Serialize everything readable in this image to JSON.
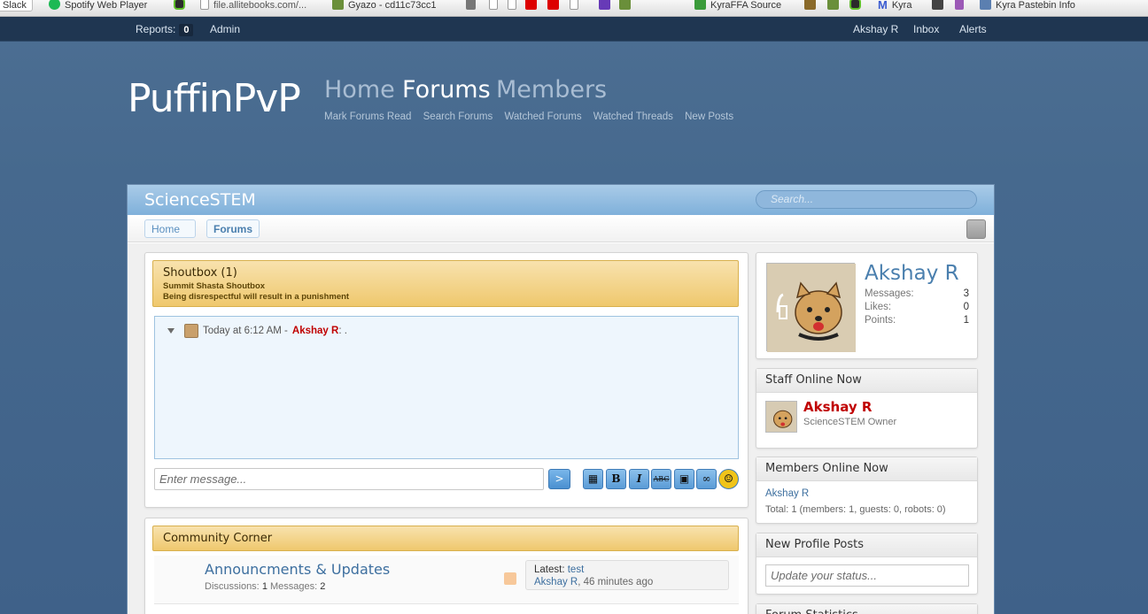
{
  "bookmarks": [
    {
      "label": "Slack"
    },
    {
      "label": "Spotify Web Player"
    },
    {
      "label": ""
    },
    {
      "label": "file.allitebooks.com/..."
    },
    {
      "label": "Gyazo - cd11c73cc1"
    },
    {
      "label": "KyraFFA Source"
    },
    {
      "label": "Kyra"
    },
    {
      "label": "Kyra Pastebin Info"
    }
  ],
  "topnav": {
    "reports_label": "Reports:",
    "reports_count": "0",
    "admin": "Admin",
    "user": "Akshay R",
    "inbox": "Inbox",
    "alerts": "Alerts"
  },
  "header": {
    "logo": "PuffinPvP",
    "tabs": [
      "Home",
      "Forums",
      "Members"
    ],
    "sublinks": [
      "Mark Forums Read",
      "Search Forums",
      "Watched Forums",
      "Watched Threads",
      "New Posts"
    ]
  },
  "site": {
    "title": "ScienceSTEM",
    "search_placeholder": "Search..."
  },
  "breadcrumb": [
    "Home",
    "Forums"
  ],
  "shoutbox": {
    "title": "Shoutbox (1)",
    "subtitle1": "Summit Shasta Shoutbox",
    "subtitle2": "Being disrespectful will result in a punishment",
    "message_time": "Today at 6:12 AM -",
    "message_user": "Akshay R",
    "message_text": ": .",
    "input_placeholder": "Enter message...",
    "send_label": ">"
  },
  "community": {
    "title": "Community Corner",
    "forum_name": "Announcments & Updates",
    "discussions_label": "Discussions:",
    "discussions": "1",
    "messages_label": "Messages:",
    "messages": "2",
    "latest_label": "Latest:",
    "latest_thread": "test",
    "latest_user": "Akshay R",
    "latest_time": ", 46 minutes ago"
  },
  "visitor": {
    "name": "Akshay R",
    "stats": [
      {
        "label": "Messages:",
        "value": "3"
      },
      {
        "label": "Likes:",
        "value": "0"
      },
      {
        "label": "Points:",
        "value": "1"
      }
    ]
  },
  "staff": {
    "title": "Staff Online Now",
    "name": "Akshay R",
    "role": "ScienceSTEM Owner"
  },
  "members_online": {
    "title": "Members Online Now",
    "member": "Akshay R",
    "total": "Total: 1 (members: 1, guests: 0, robots: 0)"
  },
  "profile_posts": {
    "title": "New Profile Posts",
    "placeholder": "Update your status..."
  },
  "forum_stats": {
    "title": "Forum Statistics"
  }
}
